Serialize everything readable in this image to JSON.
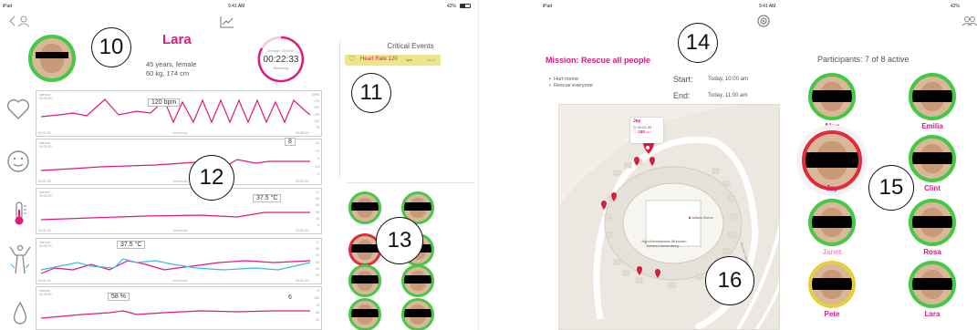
{
  "left_status": {
    "device": "iPad",
    "time": "9:41 AM",
    "battery": "42%"
  },
  "right_status": {
    "device": "iPad",
    "time": "9:41 AM",
    "battery": "42%"
  },
  "profile": {
    "name": "Lara",
    "line1": "45 years, female",
    "line2": "60 kg, 174 cm"
  },
  "timer": {
    "label": "Average: 00:30:00",
    "value": "00:22:33",
    "sub": "Remaining"
  },
  "critical": {
    "title": "Critical Events",
    "event": "Heart Rate 120",
    "unit": "bpm",
    "ago": "1m in"
  },
  "callouts": {
    "c10": "10",
    "c11": "11",
    "c12": "12",
    "c13": "13",
    "c14": "14",
    "c15": "15",
    "c16": "16"
  },
  "charts": [
    {
      "meta": "Interval\n00:30:00",
      "left_tick": "00:07:33",
      "mid_tick": "hh:mm:ss",
      "right_tick": "00:08:03",
      "value_label": "120 bpm",
      "yticks": [
        "BPM",
        "175",
        "150",
        "125",
        "100",
        "75"
      ]
    },
    {
      "meta": "Interval\n00:30:00",
      "left_tick": "00:21:33",
      "mid_tick": "hh:mm:ss",
      "right_tick": "00:22:33",
      "value_label": "8",
      "yticks": [
        "10",
        "7.5",
        "5",
        "2.5",
        "0"
      ]
    },
    {
      "meta": "Interval\n00:30:00",
      "left_tick": "00:21:33",
      "mid_tick": "hh:mm:ss",
      "right_tick": "00:22:33",
      "value_label": "37.5 °C",
      "yticks": [
        "°C",
        "60",
        "45",
        "30",
        "15",
        "0"
      ]
    },
    {
      "meta": "Interval\n00:30:00",
      "left_tick": "00:21:33",
      "mid_tick": "hh:mm:ss",
      "right_tick": "00:22:33",
      "value_label": "37.5 °C",
      "yticks": [
        "°C",
        "50",
        "40",
        "30",
        "20",
        "10"
      ]
    },
    {
      "meta": "Interval\n00:30:00",
      "left_tick": "",
      "mid_tick": "",
      "right_tick": "",
      "value_label": "58 %",
      "value_label2": "6",
      "yticks": [
        "%",
        "100",
        "75",
        "50",
        "25"
      ]
    }
  ],
  "mission": {
    "title": "Mission: Rescue all people",
    "bullets": [
      "Hurt noone",
      "Rescue everyone"
    ],
    "start_label": "Start:",
    "start_value": "Today, 10:00 am",
    "end_label": "End:",
    "end_value": "Today, 11:00 am"
  },
  "map": {
    "popup_name": "Jay",
    "popup_time": "00:22:33",
    "popup_hr": "180",
    "popup_unit": "bpm",
    "arena": "Allianz Arena",
    "bank": "HypoVereinsbank München\nWerner-Heisenberg...",
    "street": "Werner-Heisenberg-Allee"
  },
  "participants": {
    "title": "Participants: 7 of 8 active",
    "people": [
      {
        "name": "Alan",
        "ring": "#45c845"
      },
      {
        "name": "Emilia",
        "ring": "#45c845"
      },
      {
        "name": "Jay",
        "ring": "#e02b3c"
      },
      {
        "name": "Clint",
        "ring": "#45c845"
      },
      {
        "name": "Janet",
        "ring": "#45c845"
      },
      {
        "name": "Rosa",
        "ring": "#45c845"
      },
      {
        "name": "Pete",
        "ring": "#e6cf3a"
      },
      {
        "name": "Lara",
        "ring": "#45c845"
      }
    ]
  },
  "colors": {
    "accent": "#e0197d",
    "secondary": "#3fb8e6",
    "ok": "#45c845",
    "warn": "#e6cf3a",
    "alert": "#e02b3c"
  }
}
